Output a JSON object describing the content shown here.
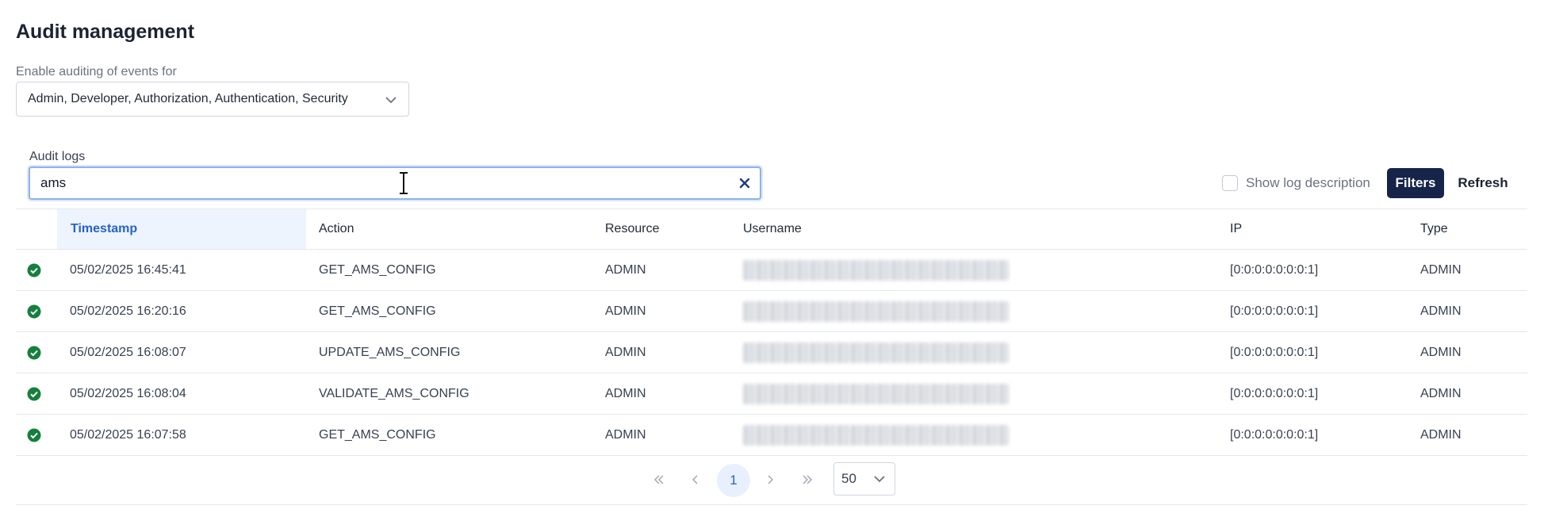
{
  "page": {
    "title": "Audit management"
  },
  "events": {
    "label": "Enable auditing of events for",
    "selected": "Admin, Developer, Authorization, Authentication, Security"
  },
  "logs": {
    "label": "Audit logs",
    "search_value": "ams",
    "show_description_label": "Show log description",
    "filters_label": "Filters",
    "refresh_label": "Refresh"
  },
  "table": {
    "columns": [
      "Timestamp",
      "Action",
      "Resource",
      "Username",
      "IP",
      "Type"
    ],
    "rows": [
      {
        "timestamp": "05/02/2025 16:45:41",
        "action": "GET_AMS_CONFIG",
        "resource": "ADMIN",
        "ip": "[0:0:0:0:0:0:0:1]",
        "type": "ADMIN"
      },
      {
        "timestamp": "05/02/2025 16:20:16",
        "action": "GET_AMS_CONFIG",
        "resource": "ADMIN",
        "ip": "[0:0:0:0:0:0:0:1]",
        "type": "ADMIN"
      },
      {
        "timestamp": "05/02/2025 16:08:07",
        "action": "UPDATE_AMS_CONFIG",
        "resource": "ADMIN",
        "ip": "[0:0:0:0:0:0:0:1]",
        "type": "ADMIN"
      },
      {
        "timestamp": "05/02/2025 16:08:04",
        "action": "VALIDATE_AMS_CONFIG",
        "resource": "ADMIN",
        "ip": "[0:0:0:0:0:0:0:1]",
        "type": "ADMIN"
      },
      {
        "timestamp": "05/02/2025 16:07:58",
        "action": "GET_AMS_CONFIG",
        "resource": "ADMIN",
        "ip": "[0:0:0:0:0:0:0:1]",
        "type": "ADMIN"
      }
    ]
  },
  "pagination": {
    "current_page": "1",
    "page_size": "50"
  },
  "colors": {
    "accent": "#2563c9",
    "primary_button": "#16244a",
    "success": "#16a34a"
  }
}
